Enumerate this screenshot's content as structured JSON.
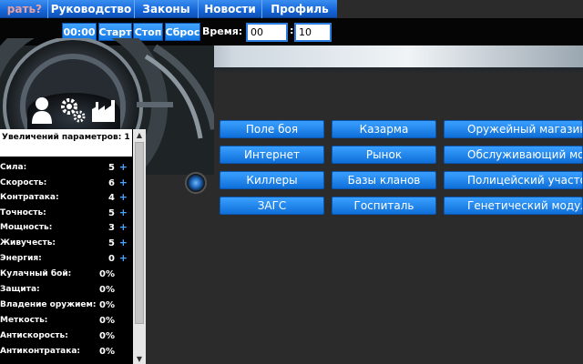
{
  "nav": {
    "items": [
      "рать?",
      "Руководство",
      "Законы",
      "Новости",
      "Профиль"
    ]
  },
  "timer": {
    "display": "00:00",
    "start_label": "Старт",
    "stop_label": "Стоп",
    "reset_label": "Сброс",
    "time_label": "Время:",
    "minutes_value": "00",
    "seconds_value": "10",
    "colon": ":"
  },
  "panel": {
    "header": "Увеличений параметров: 1",
    "stats": [
      {
        "name": "Сила:",
        "value": "5",
        "plus": "+"
      },
      {
        "name": "Скорость:",
        "value": "6",
        "plus": "+"
      },
      {
        "name": "Контратака:",
        "value": "4",
        "plus": "+"
      },
      {
        "name": "Точность:",
        "value": "5",
        "plus": "+"
      },
      {
        "name": "Мощность:",
        "value": "3",
        "plus": "+"
      },
      {
        "name": "Живучесть:",
        "value": "5",
        "plus": "+"
      },
      {
        "name": "Энергия:",
        "value": "0",
        "plus": "+"
      }
    ],
    "skills": [
      {
        "name": "Кулачный бой:",
        "value": "0%"
      },
      {
        "name": "Защита:",
        "value": "0%"
      },
      {
        "name": "Владение оружием:",
        "value": "0%"
      },
      {
        "name": "Меткость:",
        "value": "0%"
      },
      {
        "name": "Антискорость:",
        "value": "0%"
      },
      {
        "name": "Антиконтратака:",
        "value": "0%"
      }
    ],
    "scroll_up": "▲",
    "scroll_down": "▼"
  },
  "buttons": {
    "col1": [
      "Поле боя",
      "Интернет",
      "Киллеры",
      "ЗАГС"
    ],
    "col2": [
      "Казарма",
      "Рынок",
      "Базы кланов",
      "Госпиталь"
    ],
    "col3": [
      "Оружейный магазин",
      "Обслуживающий модуль",
      "Полицейский участок",
      "Генетический модуль"
    ]
  },
  "icons": [
    "user-icon",
    "gears-icon",
    "factory-icon"
  ],
  "colors": {
    "accent": "#1e88f0",
    "nav": "#1565d8",
    "panel_bg": "#000000"
  }
}
